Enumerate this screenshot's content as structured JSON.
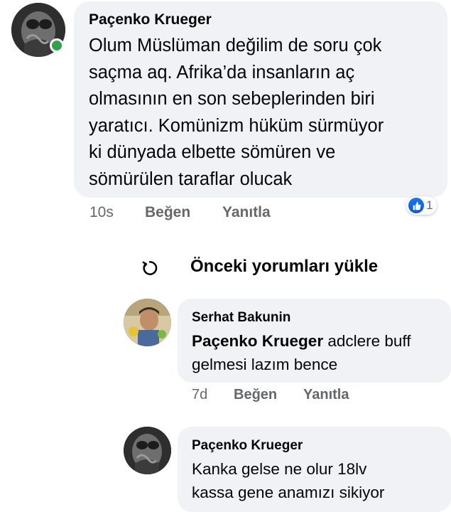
{
  "comments": [
    {
      "author": "Paçenko Krueger",
      "text_lines": [
        "Olum Müslüman değilim de soru çok",
        "saçma aq. Afrika’da insanların aç",
        "olmasının en son sebeplerinden biri",
        "yaratıcı. Komünizm hüküm sürmüyor",
        "ki dünyada elbette sömüren ve",
        "sömürülen taraflar olucak"
      ],
      "time": "10s",
      "like_label": "Beğen",
      "reply_label": "Yanıtla",
      "reaction_count": "1",
      "online": true
    }
  ],
  "load_previous": {
    "label": "Önceki yorumları yükle",
    "icon": "reload-icon"
  },
  "replies": [
    {
      "author": "Serhat Bakunin",
      "mention": "Paçenko Krueger",
      "text_first": " adclere buff",
      "text_second": "gelmesi lazım bence",
      "time": "7d",
      "like_label": "Beğen",
      "reply_label": "Yanıtla"
    },
    {
      "author": "Paçenko Krueger",
      "text_line1": "Kanka gelse ne olur 18lv",
      "text_line2": "kassa gene anamızı sikiyor"
    }
  ],
  "colors": {
    "bubble": "#f0f2f5",
    "meta": "#65676b",
    "like_blue": "#1877f2",
    "online_green": "#31a24c"
  }
}
